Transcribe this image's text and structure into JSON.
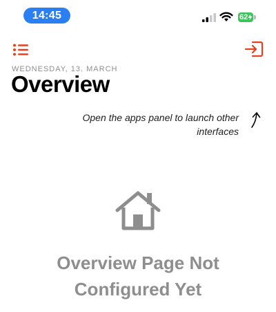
{
  "status_bar": {
    "time": "14:45",
    "battery_level": "62",
    "battery_color": "#3cc35a",
    "time_pill_color": "#2a7ff2",
    "icons": [
      "signal-icon",
      "wifi-icon",
      "battery-charging-icon"
    ]
  },
  "nav": {
    "menu_icon": "list-menu-icon",
    "logout_icon": "logout-icon",
    "accent_color": "#e8401c"
  },
  "header": {
    "date": "WEDNESDAY, 13. MARCH",
    "title": "Overview"
  },
  "hint": {
    "text": "Open the apps panel to launch other interfaces",
    "icon": "curved-arrow-up-icon"
  },
  "empty_state": {
    "icon": "house-icon",
    "message": "Overview Page Not Configured Yet"
  }
}
